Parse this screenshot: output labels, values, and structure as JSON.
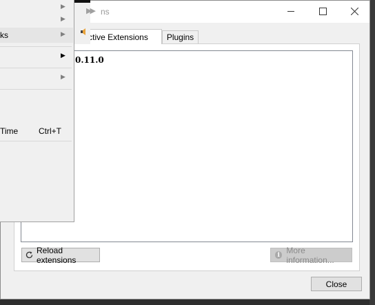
{
  "dialog": {
    "title": "ns",
    "tabs": [
      {
        "label": "ctive Extensions",
        "active": true
      },
      {
        "label": "Plugins",
        "active": false
      }
    ],
    "extensions": [
      {
        "name": "0.11.0"
      }
    ],
    "reload_label": "Reload extensions",
    "more_info_label": "More information...",
    "close_label": "Close"
  },
  "menu": {
    "items": [
      {
        "label": "",
        "shortcut": "",
        "has_submenu": true
      },
      {
        "label": "",
        "shortcut": "",
        "has_submenu": true
      },
      {
        "label": "ks",
        "shortcut": "",
        "has_submenu": true,
        "highlighted": true
      },
      {
        "label": "",
        "shortcut": "",
        "has_submenu": true
      },
      {
        "label": "",
        "shortcut": "",
        "has_submenu": true
      },
      {
        "label": "Time",
        "shortcut": "Ctrl+T",
        "has_submenu": false
      }
    ]
  },
  "colors": {
    "app_background": "#2e2e2e",
    "dialog_background": "#f0f0f0",
    "disabled_button": "#cccccc"
  }
}
